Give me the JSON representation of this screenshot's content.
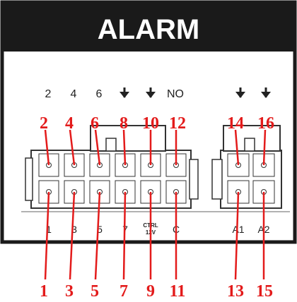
{
  "panel": {
    "header": "ALARM",
    "colors": {
      "panel_border": "#1a1a1a",
      "header_bg": "#1a1a1a",
      "header_text": "#ffffff",
      "callout": "#e31b1b",
      "connector_fill": "#ffffff",
      "label_text": "#222222"
    }
  },
  "top_labels": [
    "2",
    "4",
    "6",
    "ground-icon",
    "ground-icon",
    "NO",
    "ground-icon",
    "ground-icon"
  ],
  "bottom_labels": {
    "p1": "1",
    "p3": "3",
    "p5": "5",
    "p7": "7",
    "ctrl_line1": "CTRL",
    "ctrl_line2": "12V",
    "p11": "C",
    "p13": "A1",
    "p15": "A2"
  },
  "top_callouts": [
    "2",
    "4",
    "6",
    "8",
    "10",
    "12",
    "14",
    "16"
  ],
  "bottom_callouts": [
    "1",
    "3",
    "5",
    "7",
    "9",
    "11",
    "13",
    "15"
  ]
}
